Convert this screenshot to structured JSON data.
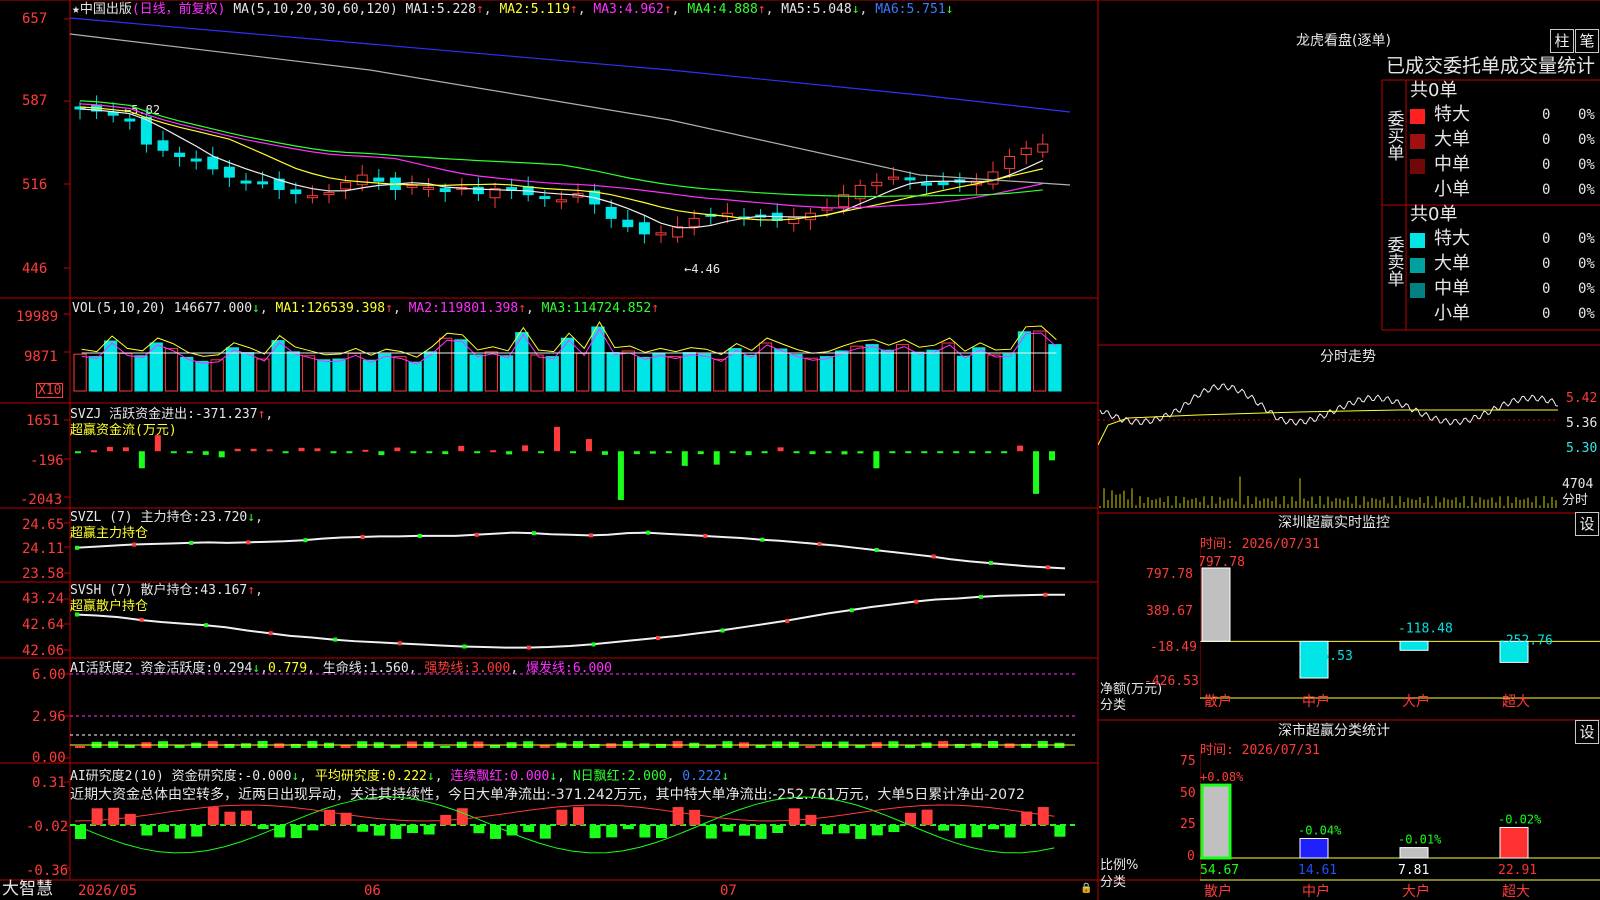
{
  "colors": {
    "up": "#ff3b3b",
    "down": "#00e5e5",
    "ma1": "#f0f0f0",
    "ma2": "#ffff2e",
    "ma3": "#ff30ff",
    "ma4": "#2fff2f",
    "ma5": "#b0b0b0",
    "ma6": "#3030ff",
    "panel_border": "#c00000",
    "grid_dash": "#c00000"
  },
  "main": {
    "stock_name": "★中国出版",
    "period_label": "(日线，前复权)",
    "ma_header": "MA(5,10,20,30,60,120)",
    "ma_values": [
      {
        "name": "MA1:",
        "value": "5.228",
        "arrow": "↑"
      },
      {
        "name": "MA2:",
        "value": "5.119",
        "arrow": "↑"
      },
      {
        "name": "MA3:",
        "value": "4.962",
        "arrow": "↑"
      },
      {
        "name": "MA4:",
        "value": "4.888",
        "arrow": "↑"
      },
      {
        "name": "MA5:",
        "value": "5.048",
        "arrow": "↓"
      },
      {
        "name": "MA6:",
        "value": "5.751",
        "arrow": "↓"
      }
    ],
    "y_ticks": [
      "657",
      "587",
      "516",
      "446"
    ],
    "high_note": "←5.82",
    "low_note": "←4.46"
  },
  "vol": {
    "header": "VOL(5,10,20)",
    "value": "146677.000",
    "value_arrow": "↓",
    "ma": [
      {
        "name": "MA1:",
        "value": "126539.398",
        "arrow": "↑"
      },
      {
        "name": "MA2:",
        "value": "119801.398",
        "arrow": "↑"
      },
      {
        "name": "MA3:",
        "value": "114724.852",
        "arrow": "↑"
      }
    ],
    "y_ticks": [
      "19989",
      "9871"
    ],
    "unit": "X10"
  },
  "svzj": {
    "name": "SVZJ",
    "label": "活跃资金进出:",
    "value": "-371.237",
    "arrow": "↑",
    "sub": "超赢资金流(万元)",
    "y_ticks": [
      "1651",
      "-196",
      "-2043"
    ]
  },
  "svzl": {
    "name": "SVZL",
    "param": "(7)",
    "label": "主力持仓:",
    "value": "23.720",
    "arrow": "↓",
    "sub": "超赢主力持仓",
    "y_ticks": [
      "24.65",
      "24.11",
      "23.58"
    ]
  },
  "svsh": {
    "name": "SVSH",
    "param": "(7)",
    "label": "散户持仓:",
    "value": "43.167",
    "arrow": "↑",
    "sub": "超赢散户持仓",
    "y_ticks": [
      "43.24",
      "42.64",
      "42.06"
    ]
  },
  "ai_active": {
    "header": "AI活跃度2",
    "label": "资金活跃度:",
    "value": "0.294",
    "arrow": "↓",
    "value2": "0.779",
    "life_label": "生命线:",
    "life_value": "1.560",
    "strong_label": "强势线:",
    "strong_value": "3.000",
    "burst_label": "爆发线:",
    "burst_value": "6.000",
    "y_ticks": [
      "6.00",
      "2.96",
      "0.00"
    ]
  },
  "ai_research": {
    "header": "AI研究度2(10)",
    "label": "资金研究度:",
    "value": "-0.000",
    "arrow": "↓",
    "avg_label": "平均研究度:",
    "avg_value": "0.222",
    "avg_arrow": "↓",
    "red_label": "连续飘红:",
    "red_value": "0.000",
    "red_arrow": "↓",
    "n_label": "N日飘红:",
    "n_value": "2.000",
    "n_extra": "0.222",
    "n_arrow": "↓",
    "comment": "近期大资金总体由空转多，近两日出现异动，关注其持续性，今日大单净流出:-371.242万元，其中特大单净流出:-252.761万元，大单5日累计净出-2072",
    "y_ticks": [
      "0.31",
      "-0.02",
      "-0.36"
    ]
  },
  "bottom_bar": {
    "brand": "大智慧",
    "dates": [
      "2026/05",
      "06",
      "07"
    ]
  },
  "dragon": {
    "title": "龙虎看盘(逐单)",
    "btn1": "柱",
    "btn2": "笔",
    "tab_header": "已成交委托单成交量统计",
    "buy": {
      "side_label": "委买单",
      "total": "共0单",
      "rows": [
        {
          "label": "特大",
          "count": "0",
          "pct": "0%",
          "color": "#ff2020"
        },
        {
          "label": "大单",
          "count": "0",
          "pct": "0%",
          "color": "#a01010"
        },
        {
          "label": "中单",
          "count": "0",
          "pct": "0%",
          "color": "#700808"
        },
        {
          "label": "小单",
          "count": "0",
          "pct": "0%",
          "color": "#000000"
        }
      ]
    },
    "sell": {
      "side_label": "委卖单",
      "total": "共0单",
      "rows": [
        {
          "label": "特大",
          "count": "0",
          "pct": "0%",
          "color": "#00e5e5"
        },
        {
          "label": "大单",
          "count": "0",
          "pct": "0%",
          "color": "#00a0a0"
        },
        {
          "label": "中单",
          "count": "0",
          "pct": "0%",
          "color": "#008080"
        },
        {
          "label": "小单",
          "count": "0",
          "pct": "0%",
          "color": "#000000"
        }
      ]
    }
  },
  "intraday": {
    "title": "分时走势",
    "prices": [
      "5.42",
      "5.36",
      "5.30"
    ],
    "vol": "4704",
    "vol_unit": "分时"
  },
  "monitor": {
    "title": "深圳超赢实时监控",
    "btn": "设",
    "time": "时间: 2026/07/31",
    "y_ticks": [
      "797.78",
      "389.67",
      "-18.49",
      "-426.53"
    ],
    "left_label1": "净额(万元)",
    "left_label2": "分类",
    "categories": [
      "散户",
      "中户",
      "大户",
      "超大"
    ],
    "values": [
      797.78,
      -426.53,
      -118.48,
      -252.76
    ],
    "value_labels": [
      "797.78",
      "-426.53",
      "-118.48",
      "-252.76"
    ]
  },
  "classify": {
    "title": "深市超赢分类统计",
    "btn": "设",
    "time": "时间: 2026/07/31",
    "y_ticks": [
      "75",
      "50",
      "25",
      "0"
    ],
    "left_label1": "比例%",
    "left_label2": "分类",
    "categories": [
      "散户",
      "中户",
      "大户",
      "超大"
    ],
    "values": [
      54.67,
      14.61,
      7.81,
      22.91
    ],
    "changes": [
      "+0.08%",
      "-0.04%",
      "-0.01%",
      "-0.02%"
    ],
    "value_labels": [
      "54.67",
      "14.61",
      "7.81",
      "22.91"
    ]
  },
  "chart_data": [
    {
      "type": "candlestick",
      "title": "中国出版 (日线，前复权)",
      "x_labels": [
        "2026/05",
        "06",
        "07"
      ],
      "ylim": [
        4.2,
        6.7
      ],
      "series": [
        {
          "name": "close (approx.)",
          "values": [
            5.76,
            5.74,
            5.7,
            5.66,
            5.42,
            5.36,
            5.3,
            5.26,
            5.18,
            5.1,
            5.06,
            5.04,
            4.98,
            4.94,
            4.92,
            4.95,
            5.05,
            5.12,
            5.06,
            4.98,
            5.02,
            5.0,
            4.96,
            5.0,
            4.94,
            4.99,
            4.97,
            4.93,
            4.91,
            4.88,
            4.94,
            4.84,
            4.7,
            4.62,
            4.55,
            4.56,
            4.62,
            4.7,
            4.73,
            4.75,
            4.71,
            4.72,
            4.68,
            4.71,
            4.75,
            4.8,
            4.93,
            5.02,
            5.05,
            5.1,
            5.08,
            5.03,
            5.04,
            5.05,
            5.06,
            5.15,
            5.3,
            5.38,
            5.42
          ]
        }
      ],
      "annotations": [
        "←5.82",
        "←4.46"
      ]
    },
    {
      "type": "bar",
      "title": "VOL(5,10,20)",
      "ylim": [
        0,
        21000
      ],
      "series": [
        {
          "name": "VOL",
          "values": [
            9200,
            8600,
            12500,
            9400,
            8800,
            12000,
            10600,
            8400,
            7400,
            7800,
            10800,
            9600,
            8000,
            12600,
            9800,
            8800,
            7800,
            8000,
            9400,
            7700,
            9200,
            8600,
            7200,
            9800,
            13200,
            12800,
            9000,
            9800,
            8800,
            14600,
            9000,
            8600,
            13200,
            9400,
            16000,
            9600,
            10000,
            8400,
            9400,
            8600,
            9600,
            9200,
            7900,
            10600,
            8900,
            12000,
            10500,
            9100,
            8200,
            8600,
            10000,
            11200,
            11600,
            10200,
            11600,
            9700,
            10200,
            12000,
            8700,
            10800,
            9000,
            9200,
            14800,
            15000,
            11600
          ]
        },
        {
          "name": "MA1",
          "values": [
            126539.398
          ]
        },
        {
          "name": "MA2",
          "values": [
            119801.398
          ]
        },
        {
          "name": "MA3",
          "values": [
            114724.852
          ]
        }
      ]
    },
    {
      "type": "bar",
      "title": "超赢资金流(万元)",
      "ylim": [
        -2043,
        1651
      ],
      "series": [
        {
          "name": "活跃资金进出",
          "values": [
            -50,
            40,
            180,
            160,
            -700,
            660,
            -60,
            -50,
            -150,
            -250,
            100,
            100,
            80,
            -80,
            140,
            120,
            -50,
            -40,
            60,
            -160,
            150,
            -60,
            -80,
            -120,
            220,
            -80,
            40,
            -130,
            240,
            -60,
            1000,
            -50,
            500,
            -150,
            -2000,
            -120,
            -100,
            -60,
            -600,
            -120,
            -550,
            -60,
            -160,
            -50,
            160,
            -60,
            -120,
            -60,
            -130,
            -90,
            -700,
            -50,
            -60,
            -70,
            -60,
            -60,
            -60,
            -70,
            -60,
            230,
            -1750,
            -371
          ]
        }
      ]
    },
    {
      "type": "line",
      "title": "超赢主力持仓",
      "ylim": [
        23.58,
        24.65
      ],
      "series": [
        {
          "name": "主力持仓",
          "values": [
            24.1,
            24.12,
            24.14,
            24.16,
            24.17,
            24.18,
            24.19,
            24.2,
            24.19,
            24.2,
            24.21,
            24.22,
            24.24,
            24.27,
            24.29,
            24.3,
            24.31,
            24.31,
            24.32,
            24.32,
            24.32,
            24.34,
            24.36,
            24.38,
            24.37,
            24.35,
            24.34,
            24.33,
            24.34,
            24.37,
            24.38,
            24.36,
            24.34,
            24.32,
            24.3,
            24.28,
            24.25,
            24.23,
            24.2,
            24.17,
            24.14,
            24.1,
            24.06,
            24.02,
            23.98,
            23.94,
            23.89,
            23.85,
            23.82,
            23.79,
            23.76,
            23.74,
            23.72
          ]
        }
      ]
    },
    {
      "type": "line",
      "title": "超赢散户持仓",
      "ylim": [
        42.06,
        43.24
      ],
      "series": [
        {
          "name": "散户持仓",
          "values": [
            42.8,
            42.78,
            42.75,
            42.7,
            42.66,
            42.63,
            42.6,
            42.56,
            42.5,
            42.45,
            42.4,
            42.37,
            42.33,
            42.3,
            42.28,
            42.26,
            42.24,
            42.22,
            42.2,
            42.19,
            42.18,
            42.18,
            42.19,
            42.21,
            42.24,
            42.28,
            42.32,
            42.36,
            42.4,
            42.45,
            42.5,
            42.56,
            42.62,
            42.68,
            42.75,
            42.82,
            42.88,
            42.94,
            42.99,
            43.04,
            43.08,
            43.1,
            43.13,
            43.15,
            43.16,
            43.17,
            43.17
          ]
        }
      ]
    },
    {
      "type": "bar",
      "title": "深圳超赢实时监控",
      "categories": [
        "散户",
        "中户",
        "大户",
        "超大"
      ],
      "values": [
        797.78,
        -426.53,
        -118.48,
        -252.76
      ],
      "ylabel": "净额(万元)",
      "ylim": [
        -426.53,
        797.78
      ]
    },
    {
      "type": "bar",
      "title": "深市超赢分类统计",
      "categories": [
        "散户",
        "中户",
        "大户",
        "超大"
      ],
      "values": [
        54.67,
        14.61,
        7.81,
        22.91
      ],
      "annotations": [
        "+0.08%",
        "-0.04%",
        "-0.01%",
        "-0.02%"
      ],
      "ylabel": "比例%",
      "ylim": [
        0,
        75
      ]
    }
  ]
}
